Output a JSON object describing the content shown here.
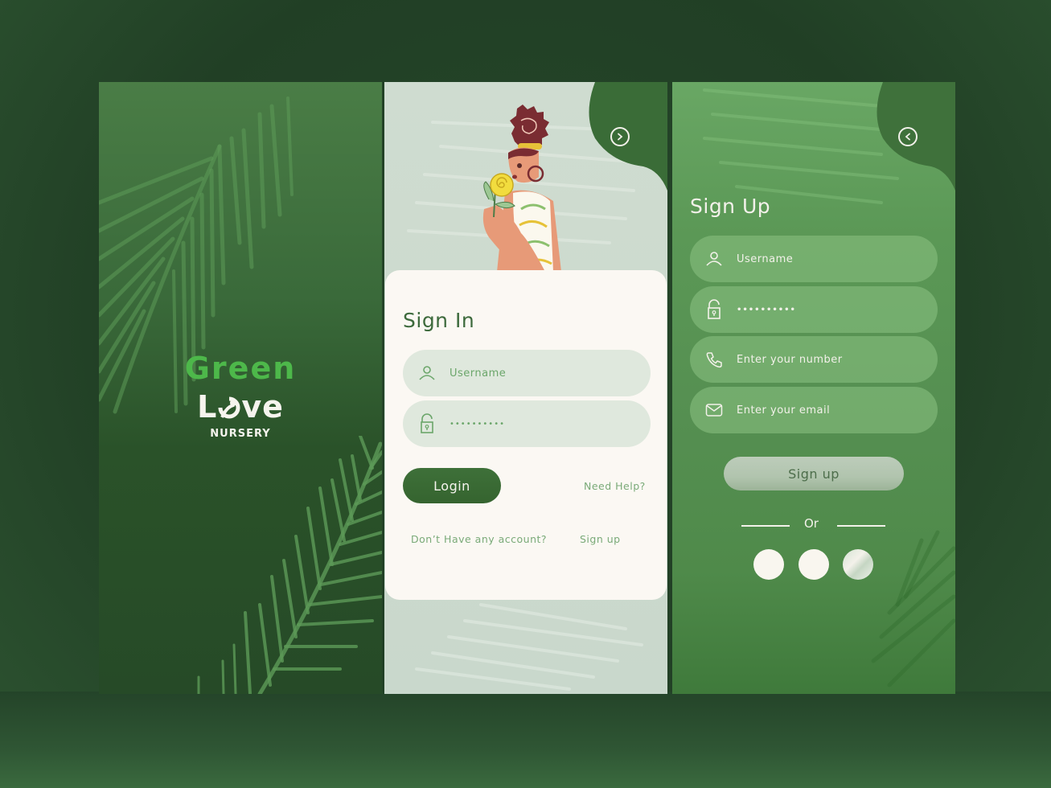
{
  "splash": {
    "brand_line1": "Green",
    "brand_line2_prefix": "L",
    "brand_line2_suffix": "ve",
    "brand_sub": "NURSERY"
  },
  "signin": {
    "title": "Sign In",
    "username_placeholder": "Username",
    "password_value": "••••••••••",
    "login_label": "Login",
    "help_link": "Need Help?",
    "no_account_text": "Don’t Have any account?",
    "signup_link": "Sign up",
    "nav_icon": "chevron-right-icon"
  },
  "signup": {
    "title": "Sign Up",
    "username_placeholder": "Username",
    "password_value": "••••••••••",
    "phone_placeholder": "Enter your number",
    "email_placeholder": "Enter your email",
    "signup_label": "Sign up",
    "or_text": "Or",
    "nav_icon": "chevron-left-icon",
    "social_buttons": [
      "social-1",
      "social-2",
      "social-3"
    ]
  },
  "colors": {
    "dark_green": "#2a5229",
    "brand_green": "#4db84a",
    "accent_green": "#3e7039",
    "cream": "#fbf8f3",
    "light_green": "#6ba66a"
  }
}
